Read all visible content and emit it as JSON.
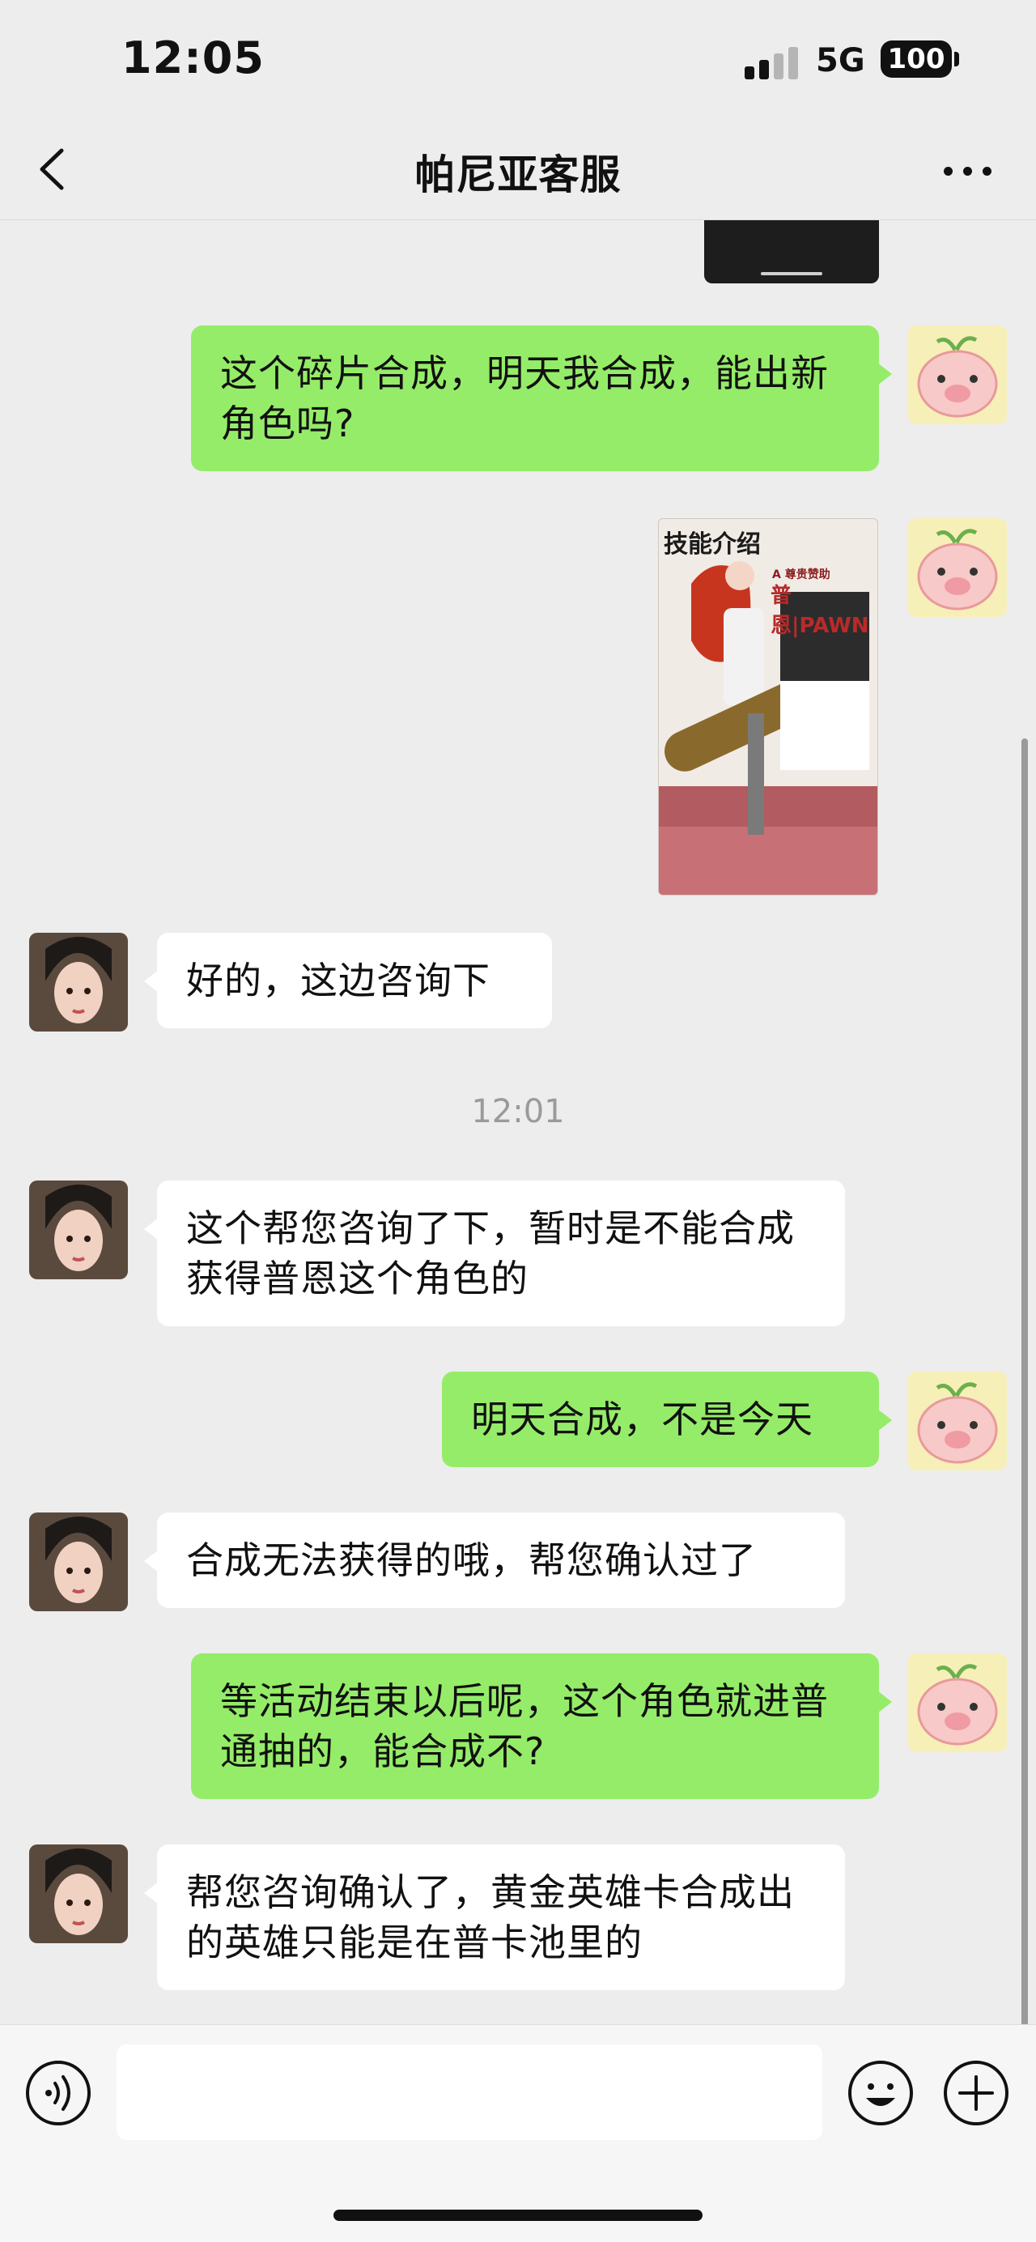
{
  "status_bar": {
    "time": "12:05",
    "network": "5G",
    "battery": "100"
  },
  "nav": {
    "title": "帕尼亚客服"
  },
  "messages": [
    {
      "side": "right",
      "text": "这个碎片合成，明天我合成，能出新角色吗?"
    },
    {
      "side": "right",
      "type": "image",
      "poster_title": "技能介绍",
      "poster_sub": "A 尊贵赞助",
      "poster_name": "普恩|PAWN"
    },
    {
      "side": "left",
      "text": "好的，这边咨询下"
    },
    {
      "type": "timestamp",
      "text": "12:01"
    },
    {
      "side": "left",
      "text": "这个帮您咨询了下，暂时是不能合成获得普恩这个角色的"
    },
    {
      "side": "right",
      "text": "明天合成，不是今天"
    },
    {
      "side": "left",
      "text": "合成无法获得的哦，帮您确认过了"
    },
    {
      "side": "right",
      "text": "等活动结束以后呢，这个角色就进普通抽的，能合成不?"
    },
    {
      "side": "left",
      "text": "帮您咨询确认了，黄金英雄卡合成出的英雄只能是在普卡池里的"
    }
  ],
  "input": {
    "placeholder": ""
  },
  "icons": {
    "back": "chevron-left-icon",
    "more": "more-dots-icon",
    "voice": "voice-icon",
    "emoji": "emoji-icon",
    "plus": "plus-icon"
  },
  "colors": {
    "background": "#ededed",
    "sent_bubble": "#95ec69",
    "received_bubble": "#ffffff",
    "timestamp_text": "#9a9a9a"
  }
}
